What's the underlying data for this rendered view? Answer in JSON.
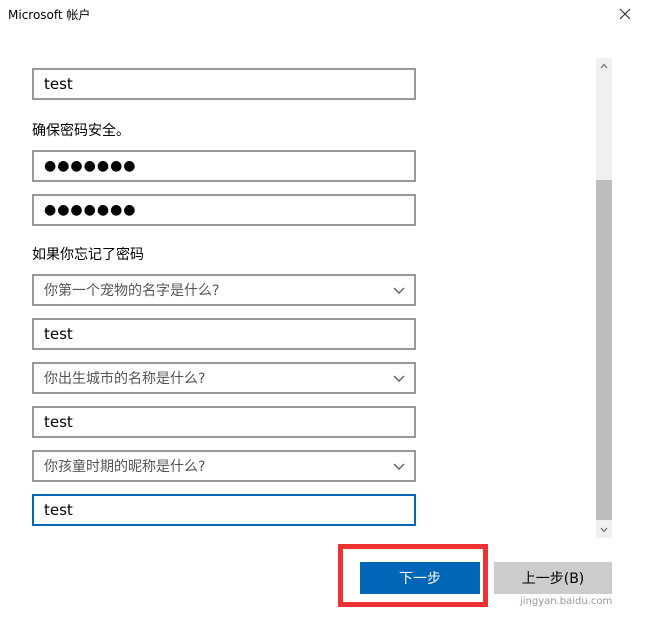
{
  "window": {
    "title": "Microsoft 帐户",
    "close_glyph": "✕"
  },
  "form": {
    "name_value": "test",
    "password_heading": "确保密码安全。",
    "password_value": "●●●●●●●",
    "confirm_password_value": "●●●●●●●",
    "recovery_heading": "如果你忘记了密码",
    "security_questions": [
      {
        "question": "你第一个宠物的名字是什么?",
        "answer": "test"
      },
      {
        "question": "你出生城市的名称是什么?",
        "answer": "test"
      },
      {
        "question": "你孩童时期的昵称是什么?",
        "answer": "test"
      }
    ]
  },
  "buttons": {
    "next_label": "下一步",
    "back_label": "上一步(B)"
  },
  "watermark": "jingyan.baidu.com",
  "colors": {
    "accent": "#0067b8",
    "highlight": "#ee3131",
    "field_border": "#999999",
    "back_button": "#cccccc"
  },
  "icons": {
    "close": "close-icon",
    "dropdown": "chevron-down-icon",
    "scroll_up": "chevron-up-icon",
    "scroll_down": "chevron-down-icon"
  }
}
